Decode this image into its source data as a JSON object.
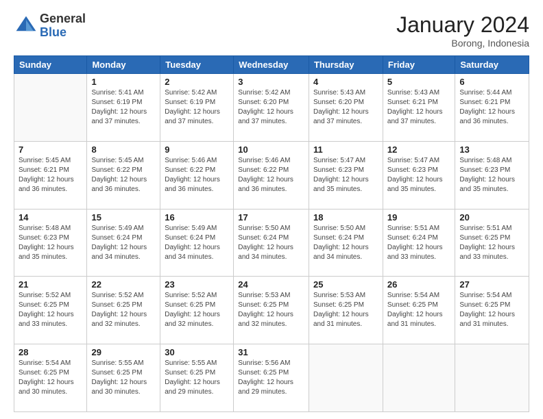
{
  "header": {
    "logo": {
      "general": "General",
      "blue": "Blue"
    },
    "title": "January 2024",
    "location": "Borong, Indonesia"
  },
  "days_of_week": [
    "Sunday",
    "Monday",
    "Tuesday",
    "Wednesday",
    "Thursday",
    "Friday",
    "Saturday"
  ],
  "weeks": [
    [
      {
        "day": "",
        "info": ""
      },
      {
        "day": "1",
        "info": "Sunrise: 5:41 AM\nSunset: 6:19 PM\nDaylight: 12 hours\nand 37 minutes."
      },
      {
        "day": "2",
        "info": "Sunrise: 5:42 AM\nSunset: 6:19 PM\nDaylight: 12 hours\nand 37 minutes."
      },
      {
        "day": "3",
        "info": "Sunrise: 5:42 AM\nSunset: 6:20 PM\nDaylight: 12 hours\nand 37 minutes."
      },
      {
        "day": "4",
        "info": "Sunrise: 5:43 AM\nSunset: 6:20 PM\nDaylight: 12 hours\nand 37 minutes."
      },
      {
        "day": "5",
        "info": "Sunrise: 5:43 AM\nSunset: 6:21 PM\nDaylight: 12 hours\nand 37 minutes."
      },
      {
        "day": "6",
        "info": "Sunrise: 5:44 AM\nSunset: 6:21 PM\nDaylight: 12 hours\nand 36 minutes."
      }
    ],
    [
      {
        "day": "7",
        "info": "Sunrise: 5:45 AM\nSunset: 6:21 PM\nDaylight: 12 hours\nand 36 minutes."
      },
      {
        "day": "8",
        "info": "Sunrise: 5:45 AM\nSunset: 6:22 PM\nDaylight: 12 hours\nand 36 minutes."
      },
      {
        "day": "9",
        "info": "Sunrise: 5:46 AM\nSunset: 6:22 PM\nDaylight: 12 hours\nand 36 minutes."
      },
      {
        "day": "10",
        "info": "Sunrise: 5:46 AM\nSunset: 6:22 PM\nDaylight: 12 hours\nand 36 minutes."
      },
      {
        "day": "11",
        "info": "Sunrise: 5:47 AM\nSunset: 6:23 PM\nDaylight: 12 hours\nand 35 minutes."
      },
      {
        "day": "12",
        "info": "Sunrise: 5:47 AM\nSunset: 6:23 PM\nDaylight: 12 hours\nand 35 minutes."
      },
      {
        "day": "13",
        "info": "Sunrise: 5:48 AM\nSunset: 6:23 PM\nDaylight: 12 hours\nand 35 minutes."
      }
    ],
    [
      {
        "day": "14",
        "info": "Sunrise: 5:48 AM\nSunset: 6:23 PM\nDaylight: 12 hours\nand 35 minutes."
      },
      {
        "day": "15",
        "info": "Sunrise: 5:49 AM\nSunset: 6:24 PM\nDaylight: 12 hours\nand 34 minutes."
      },
      {
        "day": "16",
        "info": "Sunrise: 5:49 AM\nSunset: 6:24 PM\nDaylight: 12 hours\nand 34 minutes."
      },
      {
        "day": "17",
        "info": "Sunrise: 5:50 AM\nSunset: 6:24 PM\nDaylight: 12 hours\nand 34 minutes."
      },
      {
        "day": "18",
        "info": "Sunrise: 5:50 AM\nSunset: 6:24 PM\nDaylight: 12 hours\nand 34 minutes."
      },
      {
        "day": "19",
        "info": "Sunrise: 5:51 AM\nSunset: 6:24 PM\nDaylight: 12 hours\nand 33 minutes."
      },
      {
        "day": "20",
        "info": "Sunrise: 5:51 AM\nSunset: 6:25 PM\nDaylight: 12 hours\nand 33 minutes."
      }
    ],
    [
      {
        "day": "21",
        "info": "Sunrise: 5:52 AM\nSunset: 6:25 PM\nDaylight: 12 hours\nand 33 minutes."
      },
      {
        "day": "22",
        "info": "Sunrise: 5:52 AM\nSunset: 6:25 PM\nDaylight: 12 hours\nand 32 minutes."
      },
      {
        "day": "23",
        "info": "Sunrise: 5:52 AM\nSunset: 6:25 PM\nDaylight: 12 hours\nand 32 minutes."
      },
      {
        "day": "24",
        "info": "Sunrise: 5:53 AM\nSunset: 6:25 PM\nDaylight: 12 hours\nand 32 minutes."
      },
      {
        "day": "25",
        "info": "Sunrise: 5:53 AM\nSunset: 6:25 PM\nDaylight: 12 hours\nand 31 minutes."
      },
      {
        "day": "26",
        "info": "Sunrise: 5:54 AM\nSunset: 6:25 PM\nDaylight: 12 hours\nand 31 minutes."
      },
      {
        "day": "27",
        "info": "Sunrise: 5:54 AM\nSunset: 6:25 PM\nDaylight: 12 hours\nand 31 minutes."
      }
    ],
    [
      {
        "day": "28",
        "info": "Sunrise: 5:54 AM\nSunset: 6:25 PM\nDaylight: 12 hours\nand 30 minutes."
      },
      {
        "day": "29",
        "info": "Sunrise: 5:55 AM\nSunset: 6:25 PM\nDaylight: 12 hours\nand 30 minutes."
      },
      {
        "day": "30",
        "info": "Sunrise: 5:55 AM\nSunset: 6:25 PM\nDaylight: 12 hours\nand 29 minutes."
      },
      {
        "day": "31",
        "info": "Sunrise: 5:56 AM\nSunset: 6:25 PM\nDaylight: 12 hours\nand 29 minutes."
      },
      {
        "day": "",
        "info": ""
      },
      {
        "day": "",
        "info": ""
      },
      {
        "day": "",
        "info": ""
      }
    ]
  ]
}
